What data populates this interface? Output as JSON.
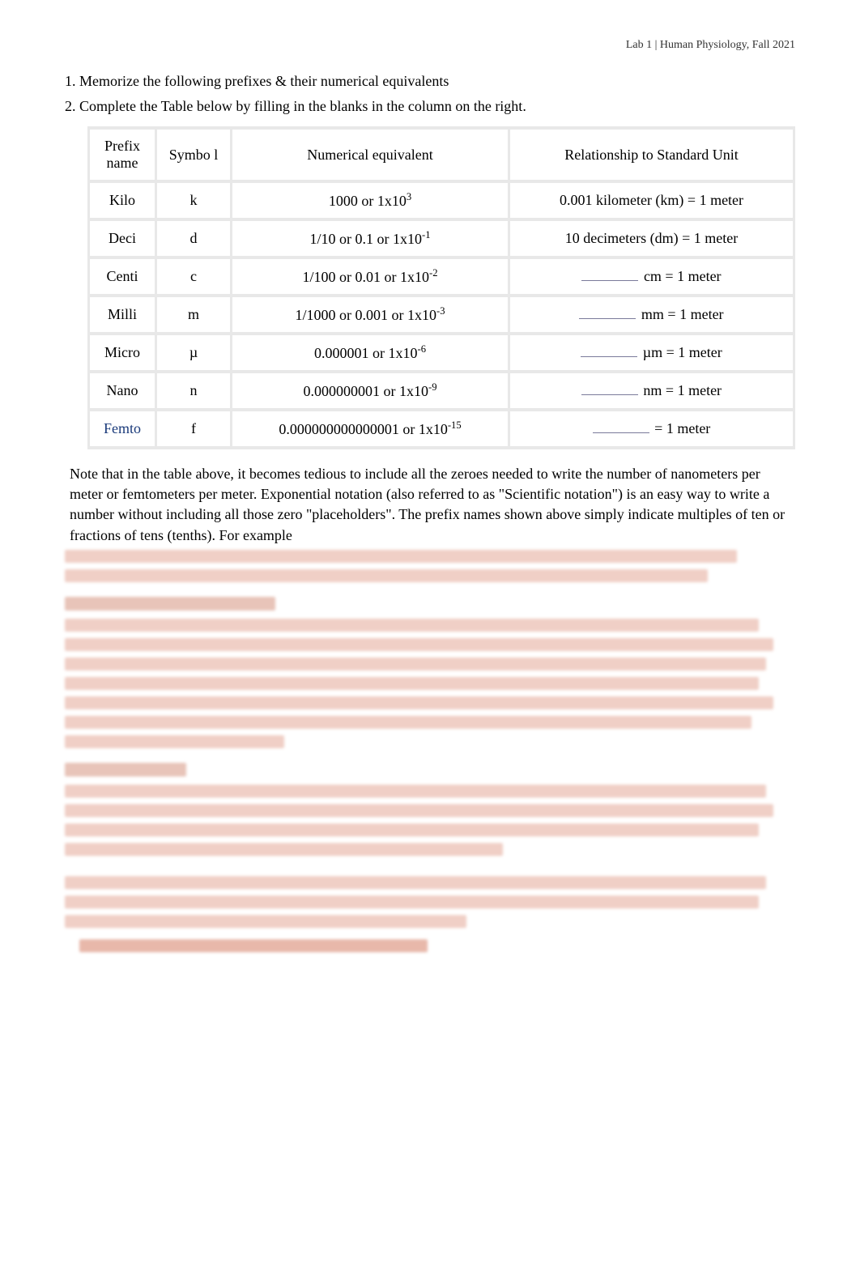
{
  "header": {
    "text": "Lab 1  | Human Physiology, Fall 2021"
  },
  "instructions": {
    "item1": "1.  Memorize the following prefixes & their numerical equivalents",
    "item2": "2.  Complete the Table below by filling in the blanks in the column on the right."
  },
  "table": {
    "headers": {
      "col1": "Prefix name",
      "col2": "Symbo l",
      "col3": "Numerical equivalent",
      "col4": "Relationship to Standard Unit"
    },
    "rows": [
      {
        "prefix": "Kilo",
        "symbol": "k",
        "numeric_plain": "1000 or 1x10",
        "numeric_exp": "3",
        "rel_prefix": "0.001 kilometer (km) = 1 meter",
        "has_blank": false
      },
      {
        "prefix": "Deci",
        "symbol": "d",
        "numeric_plain": "1/10 or 0.1 or 1x10",
        "numeric_exp": "-1",
        "rel_prefix": "10 decimeters (dm) = 1 meter",
        "has_blank": false
      },
      {
        "prefix": "Centi",
        "symbol": "c",
        "numeric_plain": "1/100 or 0.01 or 1x10",
        "numeric_exp": "-2",
        "rel_prefix": "cm = 1 meter",
        "has_blank": true
      },
      {
        "prefix": "Milli",
        "symbol": "m",
        "numeric_plain": "1/1000 or 0.001 or 1x10",
        "numeric_exp": "-3",
        "rel_prefix": "mm = 1 meter",
        "has_blank": true
      },
      {
        "prefix": "Micro",
        "symbol": "µ",
        "numeric_plain": "0.000001 or 1x10",
        "numeric_exp": "-6",
        "rel_prefix": "µm = 1 meter",
        "has_blank": true
      },
      {
        "prefix": "Nano",
        "symbol": "n",
        "numeric_plain": "0.000000001 or 1x10",
        "numeric_exp": "-9",
        "rel_prefix": "nm = 1 meter",
        "has_blank": true
      },
      {
        "prefix": "Femto",
        "symbol": "f",
        "numeric_plain": "0.000000000000001 or 1x10",
        "numeric_exp": "-15",
        "rel_prefix": " = 1 meter",
        "has_blank": true,
        "femto": true
      }
    ]
  },
  "note": {
    "text": "Note that in the table above, it becomes tedious to include all the zeroes needed to write the number of nanometers per meter or femtometers per meter. Exponential notation        (also referred to as \"Scientific notation\") is an easy way to write a number without including all those zero \"placeholders\". The prefix names shown above simply indicate multiples of ten or fractions of tens (tenths). For example"
  }
}
